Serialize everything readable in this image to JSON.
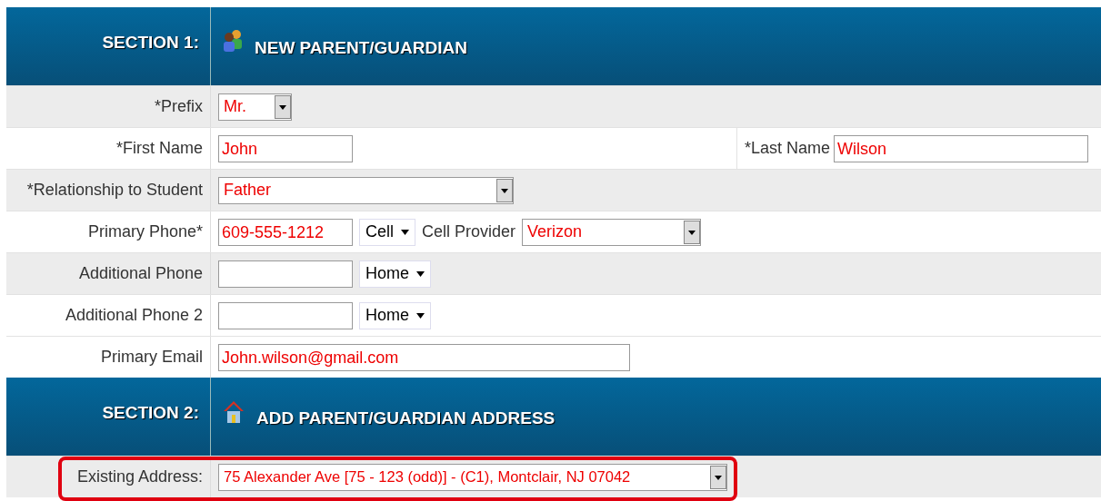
{
  "sections": [
    {
      "label": "SECTION 1:",
      "title": "NEW PARENT/GUARDIAN",
      "rows": [
        {
          "label": "*Prefix",
          "shaded": true,
          "highlighted": false,
          "controls": [
            {
              "kind": "select",
              "value": "Mr."
            }
          ]
        },
        {
          "label": "*First Name",
          "shaded": false,
          "highlighted": false,
          "controls": [
            {
              "kind": "input",
              "value": "John"
            }
          ],
          "extra": {
            "label": "*Last Name",
            "control": {
              "kind": "input",
              "value": "Wilson"
            }
          }
        },
        {
          "label": "*Relationship to Student",
          "shaded": true,
          "highlighted": false,
          "controls": [
            {
              "kind": "select",
              "value": "Father"
            }
          ]
        },
        {
          "label": "Primary Phone*",
          "shaded": false,
          "highlighted": false,
          "controls": [
            {
              "kind": "input",
              "value": "609-555-1212"
            },
            {
              "kind": "combo",
              "value": "Cell"
            },
            {
              "kind": "label",
              "value": "Cell Provider"
            },
            {
              "kind": "select",
              "value": "Verizon"
            }
          ]
        },
        {
          "label": "Additional Phone",
          "shaded": true,
          "highlighted": false,
          "controls": [
            {
              "kind": "input"
            },
            {
              "kind": "combo",
              "value": "Home"
            }
          ]
        },
        {
          "label": "Additional Phone 2",
          "shaded": false,
          "highlighted": false,
          "controls": [
            {
              "kind": "input"
            },
            {
              "kind": "combo",
              "value": "Home"
            }
          ]
        },
        {
          "label": "Primary Email",
          "shaded": false,
          "highlighted": false,
          "controls": [
            {
              "kind": "input",
              "value": "John.wilson@gmail.com"
            }
          ]
        }
      ]
    },
    {
      "label": "SECTION 2:",
      "title": "ADD PARENT/GUARDIAN ADDRESS",
      "rows": [
        {
          "label": "Existing Address:",
          "shaded": true,
          "highlighted": true,
          "controls": [
            {
              "kind": "select",
              "value": "75 Alexander Ave [75 - 123 (odd)] - (C1), Montclair, NJ 07042"
            }
          ]
        }
      ]
    }
  ]
}
